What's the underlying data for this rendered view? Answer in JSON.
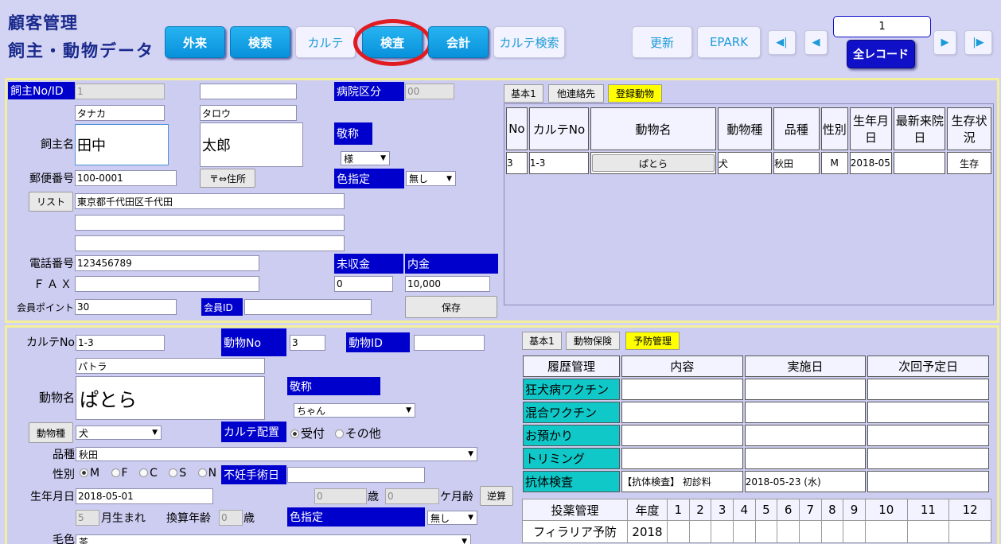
{
  "header": {
    "title_line1": "顧客管理",
    "title_line2": "飼主・動物データ",
    "buttons": {
      "outpatient": "外来",
      "search": "検索",
      "karte": "カルテ",
      "exam": "検査",
      "accounting": "会計",
      "karte_search": "カルテ検索"
    },
    "update": "更新",
    "epark": "EPARK",
    "nav": {
      "first": "◀|",
      "prev": "◀",
      "next": "▶",
      "last": "|▶"
    },
    "record_number": "1",
    "all_records": "全レコード",
    "highlight_color": "#e01c22"
  },
  "owner": {
    "labels": {
      "id": "飼主No/ID",
      "name": "飼主名",
      "postal": "郵便番号",
      "list": "リスト",
      "phone": "電話番号",
      "fax": "ＦＡＸ",
      "points": "会員ポイント",
      "member_id": "会員ID",
      "hospital": "病院区分",
      "honorific": "敬称",
      "color": "色指定",
      "unpaid": "未収金",
      "deposit": "内金",
      "postal_btn": "〒⇔住所",
      "save": "保存"
    },
    "id": "1",
    "id2": "",
    "kana_last": "タナカ",
    "kana_first": "タロウ",
    "last_name": "田中",
    "first_name": "太郎",
    "hospital_code": "00",
    "honorific": "様",
    "postal": "100-0001",
    "color": "無し",
    "address1": "東京都千代田区千代田",
    "address2": "",
    "address3": "",
    "phone": "123456789",
    "fax": "",
    "unpaid": "0",
    "deposit": "10,000",
    "points": "30",
    "member_id": ""
  },
  "animals_tabs": [
    "基本1",
    "他連絡先",
    "登録動物"
  ],
  "animals_table": {
    "headers": [
      "No",
      "カルテNo",
      "動物名",
      "動物種",
      "品種",
      "性別",
      "生年月日",
      "最新来院日",
      "生存状況"
    ],
    "rows": [
      [
        "3",
        "1-3",
        "ぱとら",
        "犬",
        "秋田",
        "M",
        "2018-05",
        "",
        "生存"
      ]
    ]
  },
  "animal": {
    "labels": {
      "karte_no": "カルテNo",
      "animal_no": "動物No",
      "animal_id": "動物ID",
      "name": "動物名",
      "honorific": "敬称",
      "species_btn": "動物種",
      "karte_place": "カルテ配置",
      "breed": "品種",
      "sex": "性別",
      "neuter": "不妊手術日",
      "birth": "生年月日",
      "age_y": "歳",
      "age_m": "ケ月齢",
      "calc": "逆算",
      "born_month": "月生まれ",
      "conv_age": "換算年齢",
      "conv_unit": "歳",
      "color": "色指定",
      "coat": "毛色"
    },
    "karte_no": "1-3",
    "animal_no": "3",
    "animal_id": "",
    "kana": "パトラ",
    "name": "ぱとら",
    "honorific": "ちゃん",
    "species": "犬",
    "placement_options": [
      "受付",
      "その他"
    ],
    "breed": "秋田",
    "sex_options": [
      "M",
      "F",
      "C",
      "S",
      "N"
    ],
    "neuter_date": "",
    "birth": "2018-05-01",
    "age_years": "0",
    "age_months": "0",
    "born_month": "5",
    "conv_age": "0",
    "color": "無し",
    "coat": "茶"
  },
  "prevent_tabs": [
    "基本1",
    "動物保険",
    "予防管理"
  ],
  "history_table": {
    "headers": [
      "履歴管理",
      "内容",
      "実施日",
      "次回予定日"
    ],
    "rows": [
      [
        "狂犬病ワクチン",
        "",
        "",
        ""
      ],
      [
        "混合ワクチン",
        "",
        "",
        ""
      ],
      [
        "お預かり",
        "",
        "",
        ""
      ],
      [
        "トリミング",
        "",
        "",
        ""
      ],
      [
        "抗体検査",
        "【抗体検査】 初診料",
        "2018-05-23 (水)",
        ""
      ]
    ]
  },
  "dosing_table": {
    "headers": [
      "投薬管理",
      "年度",
      "1",
      "2",
      "3",
      "4",
      "5",
      "6",
      "7",
      "8",
      "9",
      "10",
      "11",
      "12"
    ],
    "rows": [
      [
        "フィラリア予防",
        "2018",
        "",
        "",
        "",
        "",
        "",
        "",
        "",
        "",
        "",
        "",
        "",
        ""
      ]
    ]
  }
}
